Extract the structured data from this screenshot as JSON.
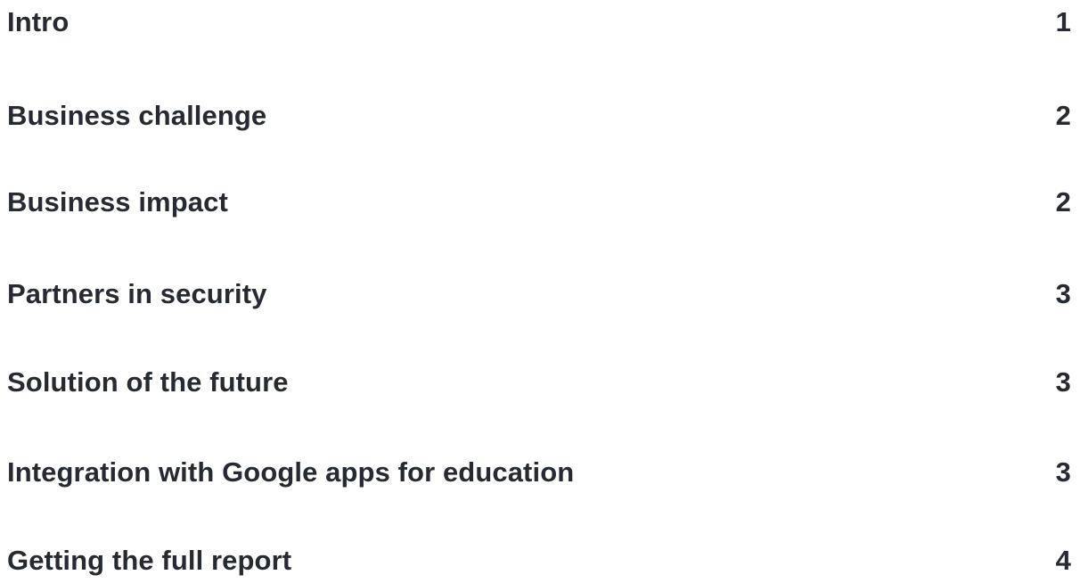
{
  "toc": {
    "entries": [
      {
        "title": "Intro",
        "page": "1"
      },
      {
        "title": "Business challenge",
        "page": "2"
      },
      {
        "title": "Business impact",
        "page": "2"
      },
      {
        "title": "Partners in security",
        "page": "3"
      },
      {
        "title": "Solution of the future",
        "page": "3"
      },
      {
        "title": "Integration with Google apps for education",
        "page": "3"
      },
      {
        "title": "Getting the full report",
        "page": "4"
      }
    ]
  }
}
